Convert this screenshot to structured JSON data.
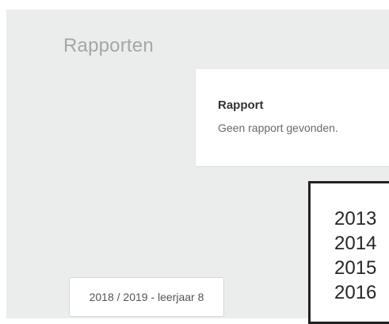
{
  "page": {
    "title": "Rapporten"
  },
  "report": {
    "heading": "Rapport",
    "message": "Geen rapport gevonden."
  },
  "year_selector": {
    "selected_label": "2018 / 2019 - leerjaar 8",
    "options": [
      "2013",
      "2014",
      "2015",
      "2016"
    ]
  }
}
